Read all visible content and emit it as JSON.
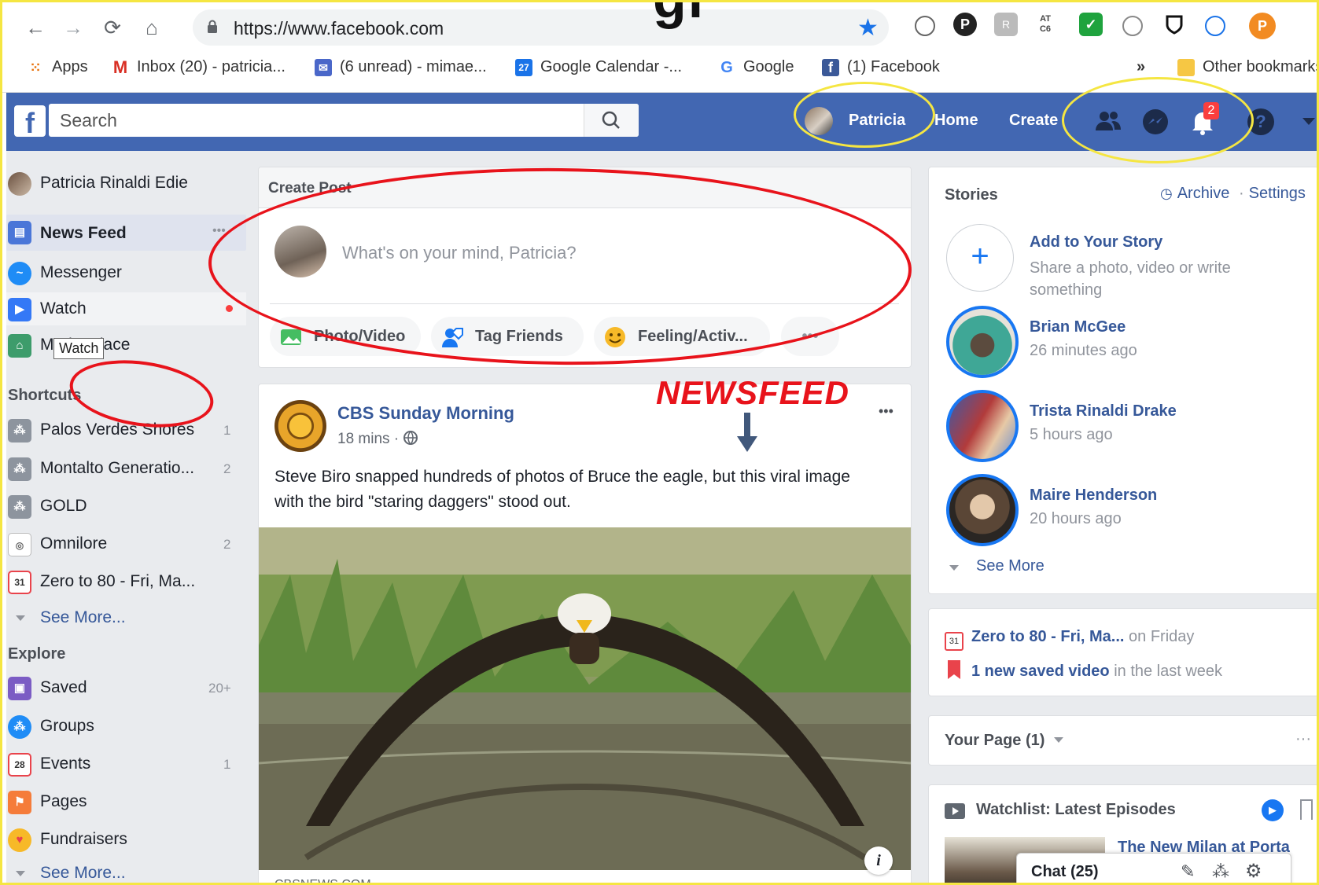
{
  "browser": {
    "url": "https://www.facebook.com",
    "bookmarks": [
      {
        "label": "Apps"
      },
      {
        "label": "Inbox (20) - patricia..."
      },
      {
        "label": "(6 unread) - mimae..."
      },
      {
        "label": "Google Calendar -..."
      },
      {
        "label": "Google"
      },
      {
        "label": "(1) Facebook"
      }
    ],
    "calendar_day": "27",
    "bookmarks_more": "»",
    "other_bookmarks": "Other bookmarks",
    "profile_initial": "P",
    "ext_badge": "AT C6"
  },
  "slide": {
    "title_fragment": "gr"
  },
  "fb_header": {
    "search_placeholder": "Search",
    "user_name": "Patricia",
    "home": "Home",
    "create": "Create",
    "notif_count": "2",
    "help": "?"
  },
  "left_nav": {
    "profile_name": "Patricia Rinaldi Edie",
    "main_items": [
      {
        "label": "News Feed"
      },
      {
        "label": "Messenger"
      },
      {
        "label": "Watch"
      },
      {
        "label": "Marketplace"
      }
    ],
    "tooltip": "Watch",
    "more_dots": "•••",
    "shortcuts_header": "Shortcuts",
    "shortcuts": [
      {
        "label": "Palos Verdes Shores",
        "count": "1"
      },
      {
        "label": "Montalto Generatio...",
        "count": "2"
      },
      {
        "label": "GOLD",
        "count": ""
      },
      {
        "label": "Omnilore",
        "count": "2"
      },
      {
        "label": "Zero to 80 - Fri, Ma...",
        "count": ""
      }
    ],
    "cal_day": "31",
    "events_day": "28",
    "see_more_1": "See More...",
    "explore_header": "Explore",
    "explore": [
      {
        "label": "Saved",
        "count": "20+"
      },
      {
        "label": "Groups",
        "count": ""
      },
      {
        "label": "Events",
        "count": "1"
      },
      {
        "label": "Pages",
        "count": ""
      },
      {
        "label": "Fundraisers",
        "count": ""
      }
    ],
    "see_more_2": "See More..."
  },
  "create_post": {
    "header": "Create Post",
    "placeholder": "What's on your mind, Patricia?",
    "actions": [
      {
        "label": "Photo/Video"
      },
      {
        "label": "Tag Friends"
      },
      {
        "label": "Feeling/Activ..."
      }
    ],
    "more": "•••"
  },
  "annotation": {
    "label": "NEWSFEED",
    "colors": {
      "red": "#e8131b",
      "yellow": "#f5e642",
      "arrow": "#41587b"
    }
  },
  "post": {
    "author": "CBS Sunday Morning",
    "time": "18 mins · ",
    "text": "Steve Biro snapped hundreds of photos of Bruce the eagle, but this viral image with the bird \"staring daggers\" stood out.",
    "source": "CBSNEWS.COM",
    "info": "i",
    "options": "•••"
  },
  "stories": {
    "header": "Stories",
    "archive": "Archive",
    "separator": "·",
    "settings": "Settings",
    "add_title": "Add to Your Story",
    "add_sub": "Share a photo, video or write something",
    "items": [
      {
        "name": "Brian McGee",
        "time": "26 minutes ago"
      },
      {
        "name": "Trista Rinaldi Drake",
        "time": "5 hours ago"
      },
      {
        "name": "Maire Henderson",
        "time": "20 hours ago"
      }
    ],
    "see_more": "See More"
  },
  "reminders": {
    "event_name": "Zero to 80 - Fri, Ma...",
    "event_when": " on Friday",
    "cal_day": "31",
    "saved_bold": "1 new saved video",
    "saved_rest": " in the last week"
  },
  "your_page": {
    "label": "Your Page (1)",
    "dots": "···"
  },
  "watchlist": {
    "title": "Watchlist: Latest Episodes",
    "episode": "The New Milan at Porta"
  },
  "chat": {
    "label": "Chat (25)"
  },
  "colors": {
    "fb_blue": "#4267b2",
    "link": "#365899",
    "bg": "#e9ebee"
  }
}
